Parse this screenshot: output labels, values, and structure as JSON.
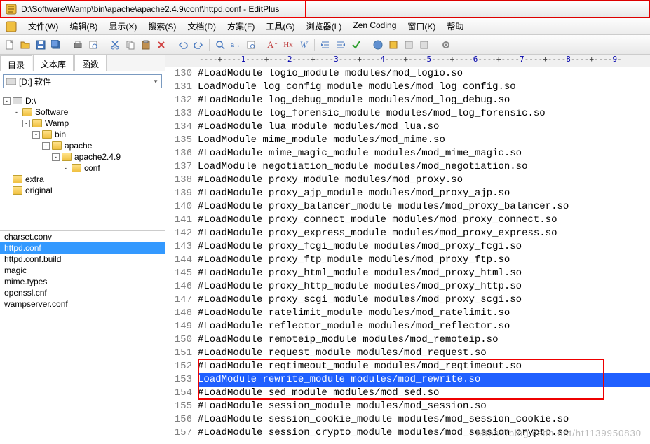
{
  "title": "D:\\Software\\Wamp\\bin\\apache\\apache2.4.9\\conf\\httpd.conf - EditPlus",
  "menu": [
    "文件(W)",
    "编辑(B)",
    "显示(X)",
    "搜索(S)",
    "文档(D)",
    "方案(F)",
    "工具(G)",
    "浏览器(L)",
    "Zen Coding",
    "窗口(K)",
    "帮助"
  ],
  "side_tabs": [
    "目录",
    "文本库",
    "函数"
  ],
  "drive_label": "[D:] 软件",
  "tree": [
    {
      "indent": 0,
      "exp": "-",
      "type": "drive",
      "label": "D:\\"
    },
    {
      "indent": 1,
      "exp": "-",
      "type": "folder",
      "label": "Software"
    },
    {
      "indent": 2,
      "exp": "-",
      "type": "folder",
      "label": "Wamp"
    },
    {
      "indent": 3,
      "exp": "-",
      "type": "folder",
      "label": "bin"
    },
    {
      "indent": 4,
      "exp": "-",
      "type": "folder",
      "label": "apache"
    },
    {
      "indent": 5,
      "exp": "-",
      "type": "folder",
      "label": "apache2.4.9"
    },
    {
      "indent": 6,
      "exp": "-",
      "type": "folder",
      "label": "conf",
      "open": true
    },
    {
      "indent": 7,
      "exp": "",
      "type": "folder",
      "label": "extra"
    },
    {
      "indent": 7,
      "exp": "",
      "type": "folder",
      "label": "original"
    }
  ],
  "files": [
    {
      "name": "charset.conv"
    },
    {
      "name": "httpd.conf",
      "selected": true
    },
    {
      "name": "httpd.conf.build"
    },
    {
      "name": "magic"
    },
    {
      "name": "mime.types"
    },
    {
      "name": "openssl.cnf"
    },
    {
      "name": "wampserver.conf"
    }
  ],
  "ruler": "----+----1----+----2----+----3----+----4----+----5----+----6----+----7----+----8----+----9-",
  "code": [
    {
      "n": 130,
      "t": "#LoadModule logio_module modules/mod_logio.so"
    },
    {
      "n": 131,
      "t": "LoadModule log_config_module modules/mod_log_config.so"
    },
    {
      "n": 132,
      "t": "#LoadModule log_debug_module modules/mod_log_debug.so"
    },
    {
      "n": 133,
      "t": "#LoadModule log_forensic_module modules/mod_log_forensic.so"
    },
    {
      "n": 134,
      "t": "#LoadModule lua_module modules/mod_lua.so"
    },
    {
      "n": 135,
      "t": "LoadModule mime_module modules/mod_mime.so"
    },
    {
      "n": 136,
      "t": "#LoadModule mime_magic_module modules/mod_mime_magic.so"
    },
    {
      "n": 137,
      "t": "LoadModule negotiation_module modules/mod_negotiation.so"
    },
    {
      "n": 138,
      "t": "#LoadModule proxy_module modules/mod_proxy.so"
    },
    {
      "n": 139,
      "t": "#LoadModule proxy_ajp_module modules/mod_proxy_ajp.so"
    },
    {
      "n": 140,
      "t": "#LoadModule proxy_balancer_module modules/mod_proxy_balancer.so"
    },
    {
      "n": 141,
      "t": "#LoadModule proxy_connect_module modules/mod_proxy_connect.so"
    },
    {
      "n": 142,
      "t": "#LoadModule proxy_express_module modules/mod_proxy_express.so"
    },
    {
      "n": 143,
      "t": "#LoadModule proxy_fcgi_module modules/mod_proxy_fcgi.so"
    },
    {
      "n": 144,
      "t": "#LoadModule proxy_ftp_module modules/mod_proxy_ftp.so"
    },
    {
      "n": 145,
      "t": "#LoadModule proxy_html_module modules/mod_proxy_html.so"
    },
    {
      "n": 146,
      "t": "#LoadModule proxy_http_module modules/mod_proxy_http.so"
    },
    {
      "n": 147,
      "t": "#LoadModule proxy_scgi_module modules/mod_proxy_scgi.so"
    },
    {
      "n": 148,
      "t": "#LoadModule ratelimit_module modules/mod_ratelimit.so"
    },
    {
      "n": 149,
      "t": "#LoadModule reflector_module modules/mod_reflector.so"
    },
    {
      "n": 150,
      "t": "#LoadModule remoteip_module modules/mod_remoteip.so"
    },
    {
      "n": 151,
      "t": "#LoadModule request_module modules/mod_request.so"
    },
    {
      "n": 152,
      "t": "#LoadModule reqtimeout_module modules/mod_reqtimeout.so"
    },
    {
      "n": 153,
      "t": "LoadModule rewrite_module modules/mod_rewrite.so",
      "hl": true
    },
    {
      "n": 154,
      "t": "#LoadModule sed_module modules/mod_sed.so"
    },
    {
      "n": 155,
      "t": "#LoadModule session_module modules/mod_session.so"
    },
    {
      "n": 156,
      "t": "#LoadModule session_cookie_module modules/mod_session_cookie.so"
    },
    {
      "n": 157,
      "t": "#LoadModule session_crypto_module modules/mod_session_crypto.so"
    }
  ],
  "highlight_box_line_index": 22,
  "watermark": "https://blog.csdn.net/ht1139950830"
}
